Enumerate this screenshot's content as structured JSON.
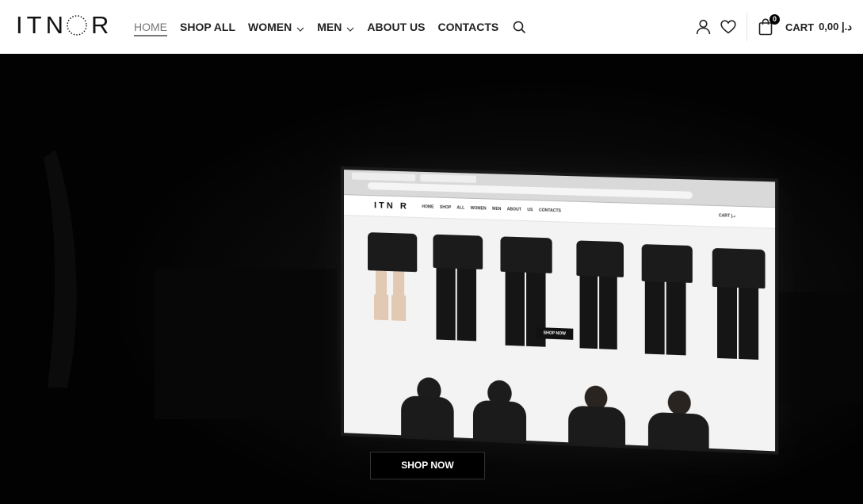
{
  "brand": {
    "logo_left": "IT",
    "logo_right": "R",
    "logo_mid": "N"
  },
  "nav": {
    "items": [
      {
        "label": "HOME",
        "active": true,
        "dropdown": false
      },
      {
        "label": "SHOP ALL",
        "active": false,
        "dropdown": false
      },
      {
        "label": "WOMEN",
        "active": false,
        "dropdown": true
      },
      {
        "label": "MEN",
        "active": false,
        "dropdown": true
      },
      {
        "label": "ABOUT US",
        "active": false,
        "dropdown": false
      },
      {
        "label": "CONTACTS",
        "active": false,
        "dropdown": false
      }
    ],
    "search_icon": "search-icon"
  },
  "header_actions": {
    "account_icon": "user-icon",
    "wishlist_icon": "heart-icon",
    "cart": {
      "count": "0",
      "label": "CART",
      "total": "د.إ 0,00",
      "icon": "shopping-bag-icon"
    }
  },
  "hero": {
    "button_label": "SHOP NOW",
    "screen": {
      "logo": "ITN R",
      "nav_text": "HOME SHOP ALL WOMEN MEN ABOUT US CONTACTS",
      "cart_text": "CART د.إ",
      "button_label": "SHOP NOW"
    }
  },
  "colors": {
    "header_bg": "#ffffff",
    "hero_bg": "#020202",
    "active_nav": "#777777",
    "text": "#222222"
  }
}
